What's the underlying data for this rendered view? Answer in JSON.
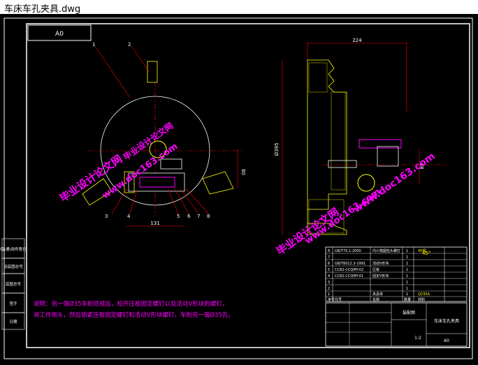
{
  "window": {
    "title": "车床车孔夹具.dwg"
  },
  "drawing": {
    "sheet_label": "A0",
    "dimensions": {
      "d224": "224",
      "d131": "131",
      "d80_left": "80",
      "d80_right": "80",
      "d395": "Ø395",
      "d45": "45°"
    },
    "part_callouts": [
      "1",
      "2",
      "3",
      "4",
      "5",
      "6",
      "7",
      "8"
    ],
    "notes": {
      "line1": "说明：另一端Ø35车削完成后，松开压板固定螺钉以及活动V形块的螺钉，",
      "line2": "将工件倒头，然后锁紧压板固定螺钉和活动V形块螺钉，车削另一端Ø35孔。"
    },
    "watermarks": {
      "w1": "毕业设计论文网",
      "w2": "www.doc163.com",
      "w3": "毕业设计论文网",
      "w4": "www.doc163.com",
      "w5": "毕业设计论文网",
      "w6": "www.doc163.com"
    },
    "bom": [
      {
        "no": "8",
        "code": "GB/T70.1-2000",
        "name": "内六角圆柱头螺钉",
        "qty": "1",
        "material": "45钢"
      },
      {
        "no": "7",
        "code": "",
        "name": "",
        "qty": "1",
        "material": ""
      },
      {
        "no": "6",
        "code": "GB/T8012.3-1991",
        "name": "活动V形块",
        "qty": "1",
        "material": ""
      },
      {
        "no": "5",
        "code": "CCB2-CCQMY-02",
        "name": "压板",
        "qty": "1",
        "material": ""
      },
      {
        "no": "4",
        "code": "CCB2-CCQMY-01",
        "name": "固定V形块",
        "qty": "1",
        "material": ""
      },
      {
        "no": "3",
        "code": "",
        "name": "",
        "qty": "1",
        "material": ""
      },
      {
        "no": "2",
        "code": "",
        "name": "",
        "qty": "1",
        "material": ""
      },
      {
        "no": "1",
        "code": "",
        "name": "夹具体",
        "qty": "1",
        "material": "Q235A"
      }
    ],
    "bom_header": {
      "no": "序号",
      "code": "代号",
      "name": "名称",
      "qty": "数量",
      "material": "材料"
    },
    "title_block": {
      "drawing_type": "装配图",
      "part_name": "车床车孔夹具",
      "size": "A0",
      "scale": "1:2"
    },
    "side_labels": [
      "借(通)用件登记",
      "旧底图总号",
      "底图总号",
      "签字",
      "日期"
    ]
  }
}
